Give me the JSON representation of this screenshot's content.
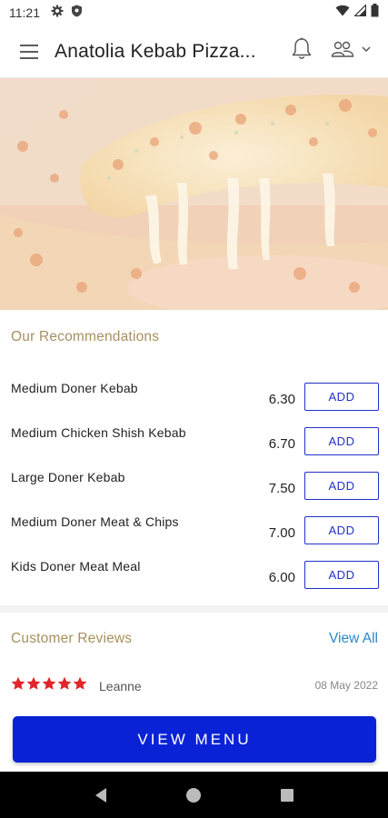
{
  "status_bar": {
    "time": "11:21",
    "left_icons": [
      "gear-icon",
      "shield-icon"
    ],
    "right_icons": [
      "wifi-icon",
      "signal-icon",
      "battery-icon"
    ]
  },
  "app_bar": {
    "title": "Anatolia Kebab Pizza...",
    "icons": [
      "menu-icon",
      "bell-icon",
      "users-icon",
      "chevron-down-icon"
    ]
  },
  "recommendations": {
    "title": "Our Recommendations",
    "add_label": "ADD",
    "items": [
      {
        "name": "Medium Doner Kebab",
        "price": "6.30"
      },
      {
        "name": "Medium Chicken Shish Kebab",
        "price": "6.70"
      },
      {
        "name": "Large Doner Kebab",
        "price": "7.50"
      },
      {
        "name": "Medium Doner Meat & Chips",
        "price": "7.00"
      },
      {
        "name": "Kids Doner Meat Meal",
        "price": "6.00"
      }
    ]
  },
  "reviews": {
    "title": "Customer Reviews",
    "view_all": "View All",
    "items": [
      {
        "stars": 5,
        "reviewer": "Leanne",
        "date": "08 May 2022"
      }
    ]
  },
  "view_menu_label": "VIEW MENU",
  "colors": {
    "accent_blue": "#0a22d6",
    "section_title": "#a8905f",
    "link": "#2a86c8",
    "star": "#e0262b"
  },
  "nav_bar": {
    "icons": [
      "back-icon",
      "home-icon",
      "recents-icon"
    ]
  }
}
